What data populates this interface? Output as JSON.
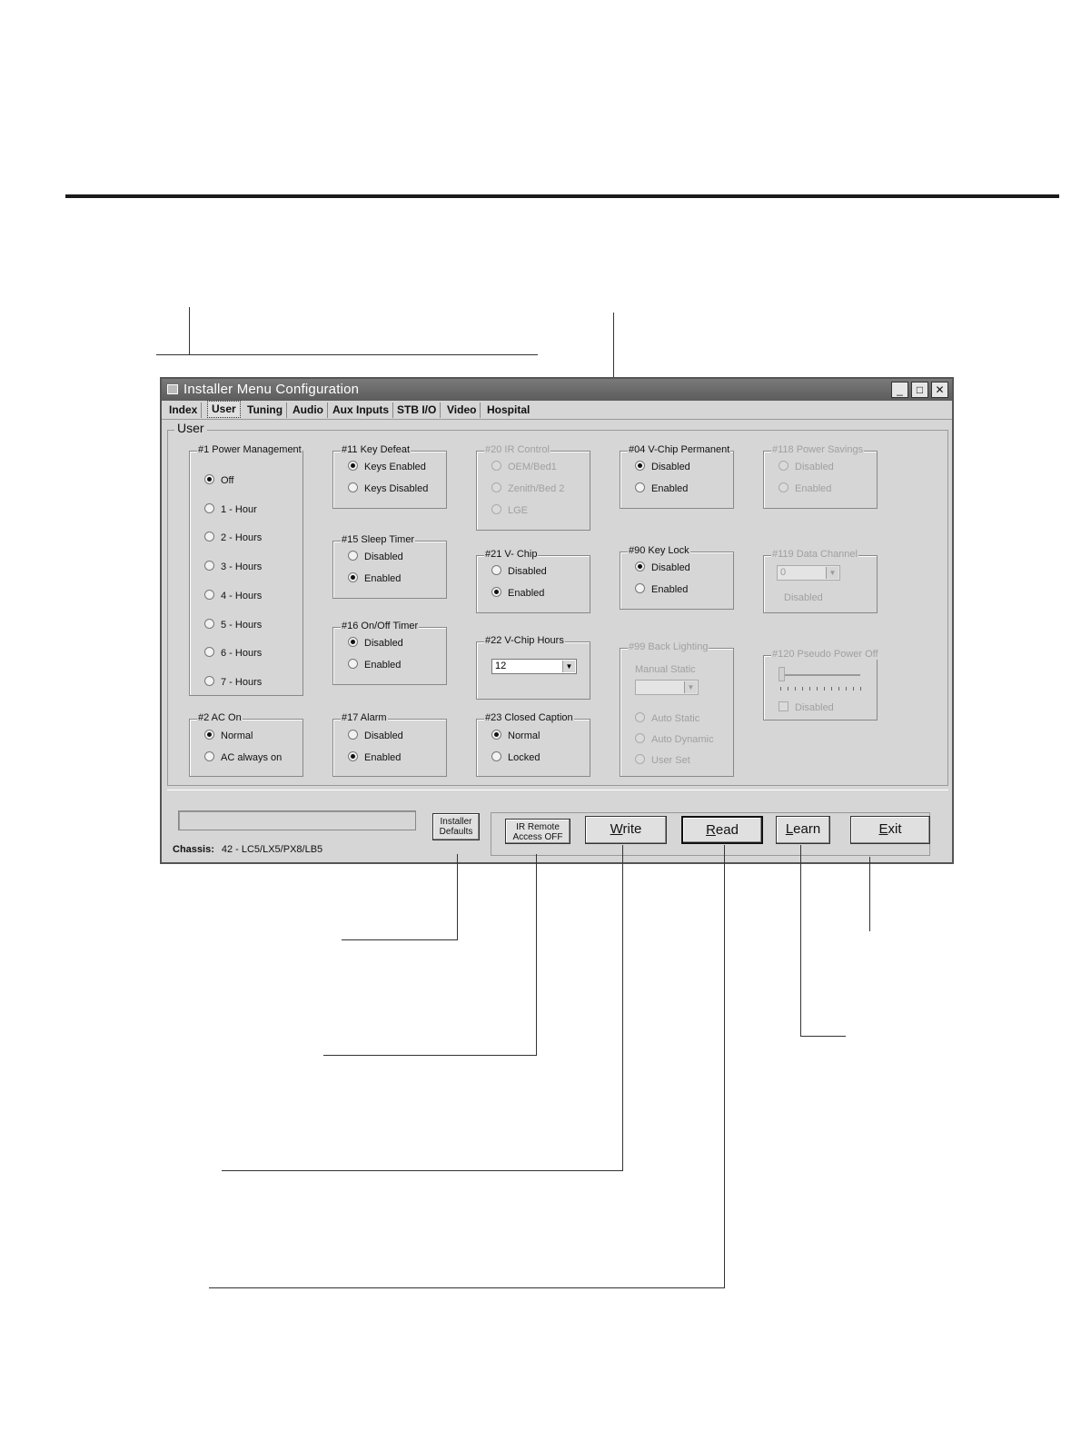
{
  "window": {
    "title": "Installer Menu Configuration",
    "min": "_",
    "max": "□",
    "close": "✕"
  },
  "tabs": [
    "Index",
    "User",
    "Tuning",
    "Audio",
    "Aux Inputs",
    "STB I/O",
    "Video",
    "Hospital"
  ],
  "active_tab": "User",
  "section_title": "User",
  "groups": {
    "power_mgmt": {
      "label": "#1 Power Management",
      "options": [
        "Off",
        "1 - Hour",
        "2 - Hours",
        "3 - Hours",
        "4 - Hours",
        "5 - Hours",
        "6 - Hours",
        "7 - Hours"
      ],
      "selected": 0
    },
    "ac_on": {
      "label": "#2 AC On",
      "options": [
        "Normal",
        "AC always on"
      ],
      "selected": 0
    },
    "key_defeat": {
      "label": "#11 Key Defeat",
      "options": [
        "Keys Enabled",
        "Keys Disabled"
      ],
      "selected": 0
    },
    "sleep_timer": {
      "label": "#15 Sleep Timer",
      "options": [
        "Disabled",
        "Enabled"
      ],
      "selected": 1
    },
    "onoff_timer": {
      "label": "#16 On/Off Timer",
      "options": [
        "Disabled",
        "Enabled"
      ],
      "selected": 0
    },
    "alarm": {
      "label": "#17 Alarm",
      "options": [
        "Disabled",
        "Enabled"
      ],
      "selected": 1
    },
    "ir_control": {
      "label": "#20 IR Control",
      "options": [
        "OEM/Bed1",
        "Zenith/Bed 2",
        "LGE"
      ],
      "selected": -1
    },
    "vchip": {
      "label": "#21 V- Chip",
      "options": [
        "Disabled",
        "Enabled"
      ],
      "selected": 1
    },
    "vchip_hours": {
      "label": "#22 V-Chip Hours",
      "value": "12"
    },
    "closed_caption": {
      "label": "#23 Closed Caption",
      "options": [
        "Normal",
        "Locked"
      ],
      "selected": 0
    },
    "vchip_perm": {
      "label": "#04 V-Chip Permanent",
      "options": [
        "Disabled",
        "Enabled"
      ],
      "selected": 0
    },
    "key_lock": {
      "label": "#90 Key Lock",
      "options": [
        "Disabled",
        "Enabled"
      ],
      "selected": 0
    },
    "back_lighting": {
      "label": "#99 Back Lighting",
      "sublabel": "Manual Static",
      "options": [
        "Auto Static",
        "Auto Dynamic",
        "User Set"
      ],
      "selected": -1
    },
    "power_savings": {
      "label": "#118 Power Savings",
      "options": [
        "Disabled",
        "Enabled"
      ],
      "selected": -1
    },
    "data_channel": {
      "label": "#119 Data Channel",
      "value": "0",
      "status": "Disabled"
    },
    "pseudo_power": {
      "label": "#120 Pseudo Power Off",
      "checkbox": "Disabled"
    }
  },
  "status_bar": {
    "chassis_label": "Chassis:",
    "chassis_value": "42 - LC5/LX5/PX8/LB5"
  },
  "buttons": {
    "installer_defaults": [
      "Installer",
      "Defaults"
    ],
    "ir_remote": [
      "IR Remote",
      "Access OFF"
    ],
    "write": "Write",
    "read": "Read",
    "learn": "Learn",
    "exit": "Exit"
  }
}
